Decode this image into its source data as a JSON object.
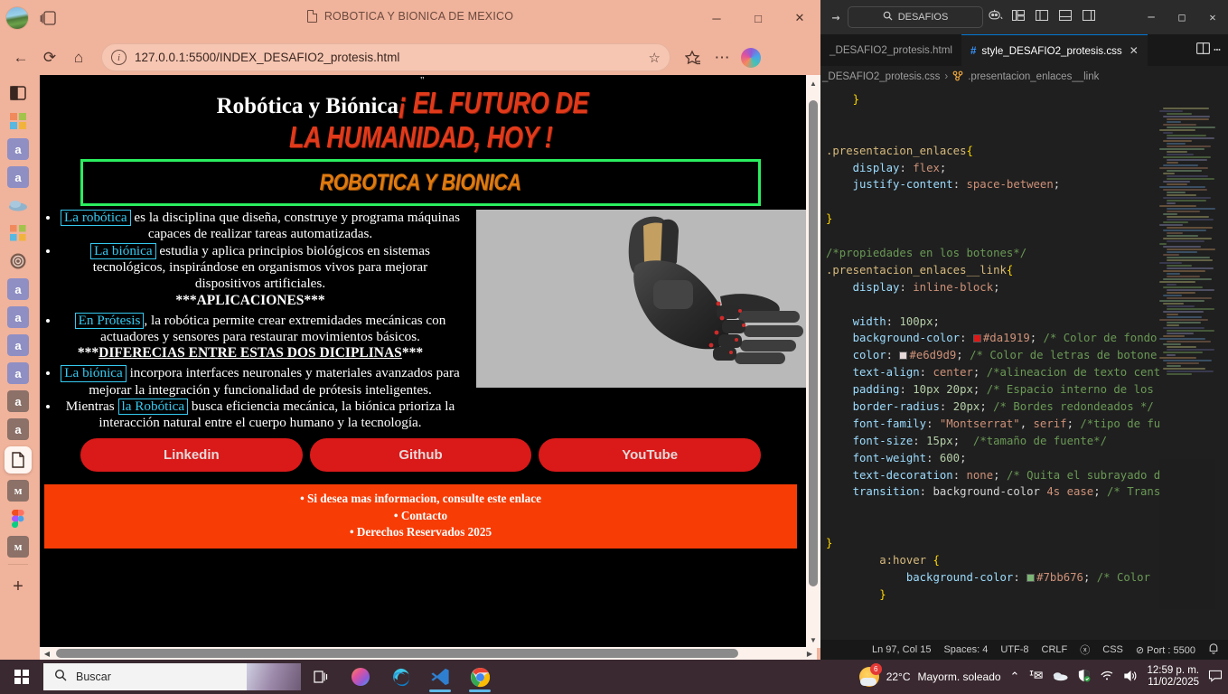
{
  "browser": {
    "title": "ROBOTICA Y BIONICA DE MEXICO",
    "url": "127.0.0.1:5500/INDEX_DESAFIO2_protesis.html",
    "minimize": "─",
    "maximize": "□",
    "close": "✕",
    "back": "←",
    "reload": "⟳",
    "home": "⌂",
    "star": "☆",
    "favorites": "☰",
    "more": "⋯"
  },
  "page": {
    "top_mark": "\"",
    "title_white": "Robótica y Biónica",
    "title_red_line1": "¡ EL FUTURO DE",
    "title_red_line2": "LA HUMANIDAD, HOY !",
    "banner": "ROBOTICA Y BIONICA",
    "items": [
      {
        "tag": "La robótica",
        "text": " es la disciplina que diseña, construye y programa máquinas capaces de realizar tareas automatizadas."
      },
      {
        "tag": "La biónica",
        "text": " estudia y aplica principios biológicos en sistemas tecnológicos, inspirándose en organismos vivos para mejorar dispositivos artificiales."
      }
    ],
    "section_aplicaciones": "***APLICACIONES***",
    "item_protesis": {
      "tag": "En Prótesis",
      "text": ", la robótica permite crear extremidades mecánicas con actuadores y sensores para restaurar movimientos básicos."
    },
    "section_diferencias_pre": "***",
    "section_diferencias": "DIFERECIAS ENTRE ESTAS DOS DICIPLINAS",
    "section_diferencias_post": "***",
    "item_bionica2": {
      "tag": "La biónica",
      "text": " incorpora interfaces neuronales y materiales avanzados para mejorar la integración y funcionalidad de prótesis inteligentes."
    },
    "item_mientras": {
      "pre": "Mientras ",
      "tag": "la Robótica",
      "text": " busca eficiencia mecánica, la biónica prioriza la interacción natural entre el cuerpo humano y la tecnología."
    },
    "buttons": [
      {
        "label": "Linkedin"
      },
      {
        "label": "Github"
      },
      {
        "label": "YouTube"
      }
    ],
    "footer": [
      "Si desea mas informacion, consulte este enlace",
      "Contacto",
      "Derechos Reservados 2025"
    ],
    "image_alt": "protesis-robotica-brazo"
  },
  "vscode": {
    "forward_arrow": "→",
    "search_placeholder": "DESAFIOS",
    "layout_icons": [
      "▣",
      "◫",
      "▤",
      "◫"
    ],
    "minimize": "─",
    "maximize": "□",
    "close": "✕",
    "tabs": [
      {
        "label": "_DESAFIO2_protesis.html",
        "active": false
      },
      {
        "label": "style_DESAFIO2_protesis.css",
        "active": true,
        "icon": "#"
      }
    ],
    "split_editor": "◫",
    "more_actions": "⋯",
    "breadcrumb": {
      "file": "_DESAFIO2_protesis.css",
      "separator": "›",
      "symbol": ".presentacion_enlaces__link"
    },
    "status": {
      "position": "Ln 97, Col 15",
      "spaces": "Spaces: 4",
      "encoding": "UTF-8",
      "eol": "CRLF",
      "language": "CSS",
      "port": "Port : 5500",
      "bell": "⌕",
      "live": "ⓧ"
    },
    "code_lines": [
      {
        "indent": 1,
        "tokens": [
          {
            "t": "}",
            "c": "tk-y"
          }
        ]
      },
      {
        "indent": 0,
        "tokens": []
      },
      {
        "indent": 0,
        "tokens": []
      },
      {
        "indent": 0,
        "tokens": [
          {
            "t": ".presentacion_enlaces",
            "c": "tk-sel"
          },
          {
            "t": "{",
            "c": "tk-y"
          }
        ]
      },
      {
        "indent": 1,
        "tokens": [
          {
            "t": "display",
            "c": "tk-prop"
          },
          {
            "t": ": ",
            "c": "tk-w"
          },
          {
            "t": "flex",
            "c": "tk-val"
          },
          {
            "t": ";",
            "c": "tk-w"
          }
        ]
      },
      {
        "indent": 1,
        "tokens": [
          {
            "t": "justify-content",
            "c": "tk-prop"
          },
          {
            "t": ": ",
            "c": "tk-w"
          },
          {
            "t": "space-between",
            "c": "tk-val"
          },
          {
            "t": ";",
            "c": "tk-w"
          }
        ]
      },
      {
        "indent": 0,
        "tokens": []
      },
      {
        "indent": 0,
        "tokens": [
          {
            "t": "}",
            "c": "tk-y"
          }
        ]
      },
      {
        "indent": 0,
        "tokens": []
      },
      {
        "indent": 0,
        "tokens": [
          {
            "t": "/*propiedades en los botones*/",
            "c": "tk-com"
          }
        ]
      },
      {
        "indent": 0,
        "tokens": [
          {
            "t": ".presentacion_enlaces__link",
            "c": "tk-sel"
          },
          {
            "t": "{",
            "c": "tk-y"
          }
        ]
      },
      {
        "indent": 1,
        "tokens": [
          {
            "t": "display",
            "c": "tk-prop"
          },
          {
            "t": ": ",
            "c": "tk-w"
          },
          {
            "t": "inline-block",
            "c": "tk-val"
          },
          {
            "t": ";",
            "c": "tk-w"
          }
        ]
      },
      {
        "indent": 0,
        "tokens": []
      },
      {
        "indent": 1,
        "tokens": [
          {
            "t": "width",
            "c": "tk-prop"
          },
          {
            "t": ": ",
            "c": "tk-w"
          },
          {
            "t": "100px",
            "c": "tk-num"
          },
          {
            "t": ";",
            "c": "tk-w"
          }
        ]
      },
      {
        "indent": 1,
        "swatch": "#da1919",
        "tokens": [
          {
            "t": "background-color",
            "c": "tk-prop"
          },
          {
            "t": ": ",
            "c": "tk-w"
          },
          {
            "t": "#da1919",
            "c": "tk-val"
          },
          {
            "t": "; ",
            "c": "tk-w"
          },
          {
            "t": "/* Color de fondo",
            "c": "tk-com"
          }
        ]
      },
      {
        "indent": 1,
        "swatch": "#e6d9d9",
        "tokens": [
          {
            "t": "color",
            "c": "tk-prop"
          },
          {
            "t": ": ",
            "c": "tk-w"
          },
          {
            "t": "#e6d9d9",
            "c": "tk-val"
          },
          {
            "t": "; ",
            "c": "tk-w"
          },
          {
            "t": "/* Color de letras de botone",
            "c": "tk-com"
          }
        ]
      },
      {
        "indent": 1,
        "tokens": [
          {
            "t": "text-align",
            "c": "tk-prop"
          },
          {
            "t": ": ",
            "c": "tk-w"
          },
          {
            "t": "center",
            "c": "tk-val"
          },
          {
            "t": "; ",
            "c": "tk-w"
          },
          {
            "t": "/*alineacion de texto cent",
            "c": "tk-com"
          }
        ]
      },
      {
        "indent": 1,
        "tokens": [
          {
            "t": "padding",
            "c": "tk-prop"
          },
          {
            "t": ": ",
            "c": "tk-w"
          },
          {
            "t": "10px 20px",
            "c": "tk-num"
          },
          {
            "t": "; ",
            "c": "tk-w"
          },
          {
            "t": "/* Espacio interno de los",
            "c": "tk-com"
          }
        ]
      },
      {
        "indent": 1,
        "tokens": [
          {
            "t": "border-radius",
            "c": "tk-prop"
          },
          {
            "t": ": ",
            "c": "tk-w"
          },
          {
            "t": "20px",
            "c": "tk-num"
          },
          {
            "t": "; ",
            "c": "tk-w"
          },
          {
            "t": "/* Bordes redondeados */",
            "c": "tk-com"
          }
        ]
      },
      {
        "indent": 1,
        "tokens": [
          {
            "t": "font-family",
            "c": "tk-prop"
          },
          {
            "t": ": ",
            "c": "tk-w"
          },
          {
            "t": "\"Montserrat\"",
            "c": "tk-val"
          },
          {
            "t": ", ",
            "c": "tk-w"
          },
          {
            "t": "serif",
            "c": "tk-val"
          },
          {
            "t": "; ",
            "c": "tk-w"
          },
          {
            "t": "/*tipo de fu",
            "c": "tk-com"
          }
        ]
      },
      {
        "indent": 1,
        "tokens": [
          {
            "t": "font-size",
            "c": "tk-prop"
          },
          {
            "t": ": ",
            "c": "tk-w"
          },
          {
            "t": "15px",
            "c": "tk-num"
          },
          {
            "t": ";  ",
            "c": "tk-w"
          },
          {
            "t": "/*tamaño de fuente*/",
            "c": "tk-com"
          }
        ]
      },
      {
        "indent": 1,
        "tokens": [
          {
            "t": "font-weight",
            "c": "tk-prop"
          },
          {
            "t": ": ",
            "c": "tk-w"
          },
          {
            "t": "600",
            "c": "tk-num"
          },
          {
            "t": ";",
            "c": "tk-w"
          }
        ]
      },
      {
        "indent": 1,
        "tokens": [
          {
            "t": "text-decoration",
            "c": "tk-prop"
          },
          {
            "t": ": ",
            "c": "tk-w"
          },
          {
            "t": "none",
            "c": "tk-val"
          },
          {
            "t": "; ",
            "c": "tk-w"
          },
          {
            "t": "/* Quita el subrayado d",
            "c": "tk-com"
          }
        ]
      },
      {
        "indent": 1,
        "tokens": [
          {
            "t": "transition",
            "c": "tk-prop"
          },
          {
            "t": ": ",
            "c": "tk-w"
          },
          {
            "t": "background-color",
            "c": "tk-w"
          },
          {
            "t": " ",
            "c": "tk-w"
          },
          {
            "t": "4s",
            "c": "tk-val"
          },
          {
            "t": " ",
            "c": "tk-w"
          },
          {
            "t": "ease",
            "c": "tk-val"
          },
          {
            "t": "; ",
            "c": "tk-w"
          },
          {
            "t": "/* Trans",
            "c": "tk-com"
          }
        ]
      },
      {
        "indent": 0,
        "tokens": []
      },
      {
        "indent": 0,
        "tokens": []
      },
      {
        "indent": 0,
        "tokens": [
          {
            "t": "}",
            "c": "tk-y"
          }
        ]
      },
      {
        "indent": 2,
        "tokens": [
          {
            "t": "a:hover",
            "c": "tk-sel"
          },
          {
            "t": " ",
            "c": "tk-w"
          },
          {
            "t": "{",
            "c": "tk-y"
          }
        ]
      },
      {
        "indent": 3,
        "swatch": "#7bb676",
        "tokens": [
          {
            "t": "background-color",
            "c": "tk-prop"
          },
          {
            "t": ": ",
            "c": "tk-w"
          },
          {
            "t": "#7bb676",
            "c": "tk-val"
          },
          {
            "t": "; ",
            "c": "tk-w"
          },
          {
            "t": "/* Color",
            "c": "tk-com"
          }
        ]
      },
      {
        "indent": 2,
        "tokens": [
          {
            "t": "}",
            "c": "tk-y"
          }
        ]
      }
    ]
  },
  "taskbar": {
    "search_placeholder": "Buscar",
    "apps": [
      "task-view",
      "copilot",
      "edge",
      "vscode",
      "chrome"
    ],
    "weather_temp": "22°C",
    "weather_desc": "Mayorm. soleado",
    "weather_badge": "6",
    "time": "12:59 p. m.",
    "date": "11/02/2025",
    "tray_icons": [
      "∧",
      "⌨",
      "☁",
      "⛨",
      "◔",
      "ᵒ"
    ]
  }
}
